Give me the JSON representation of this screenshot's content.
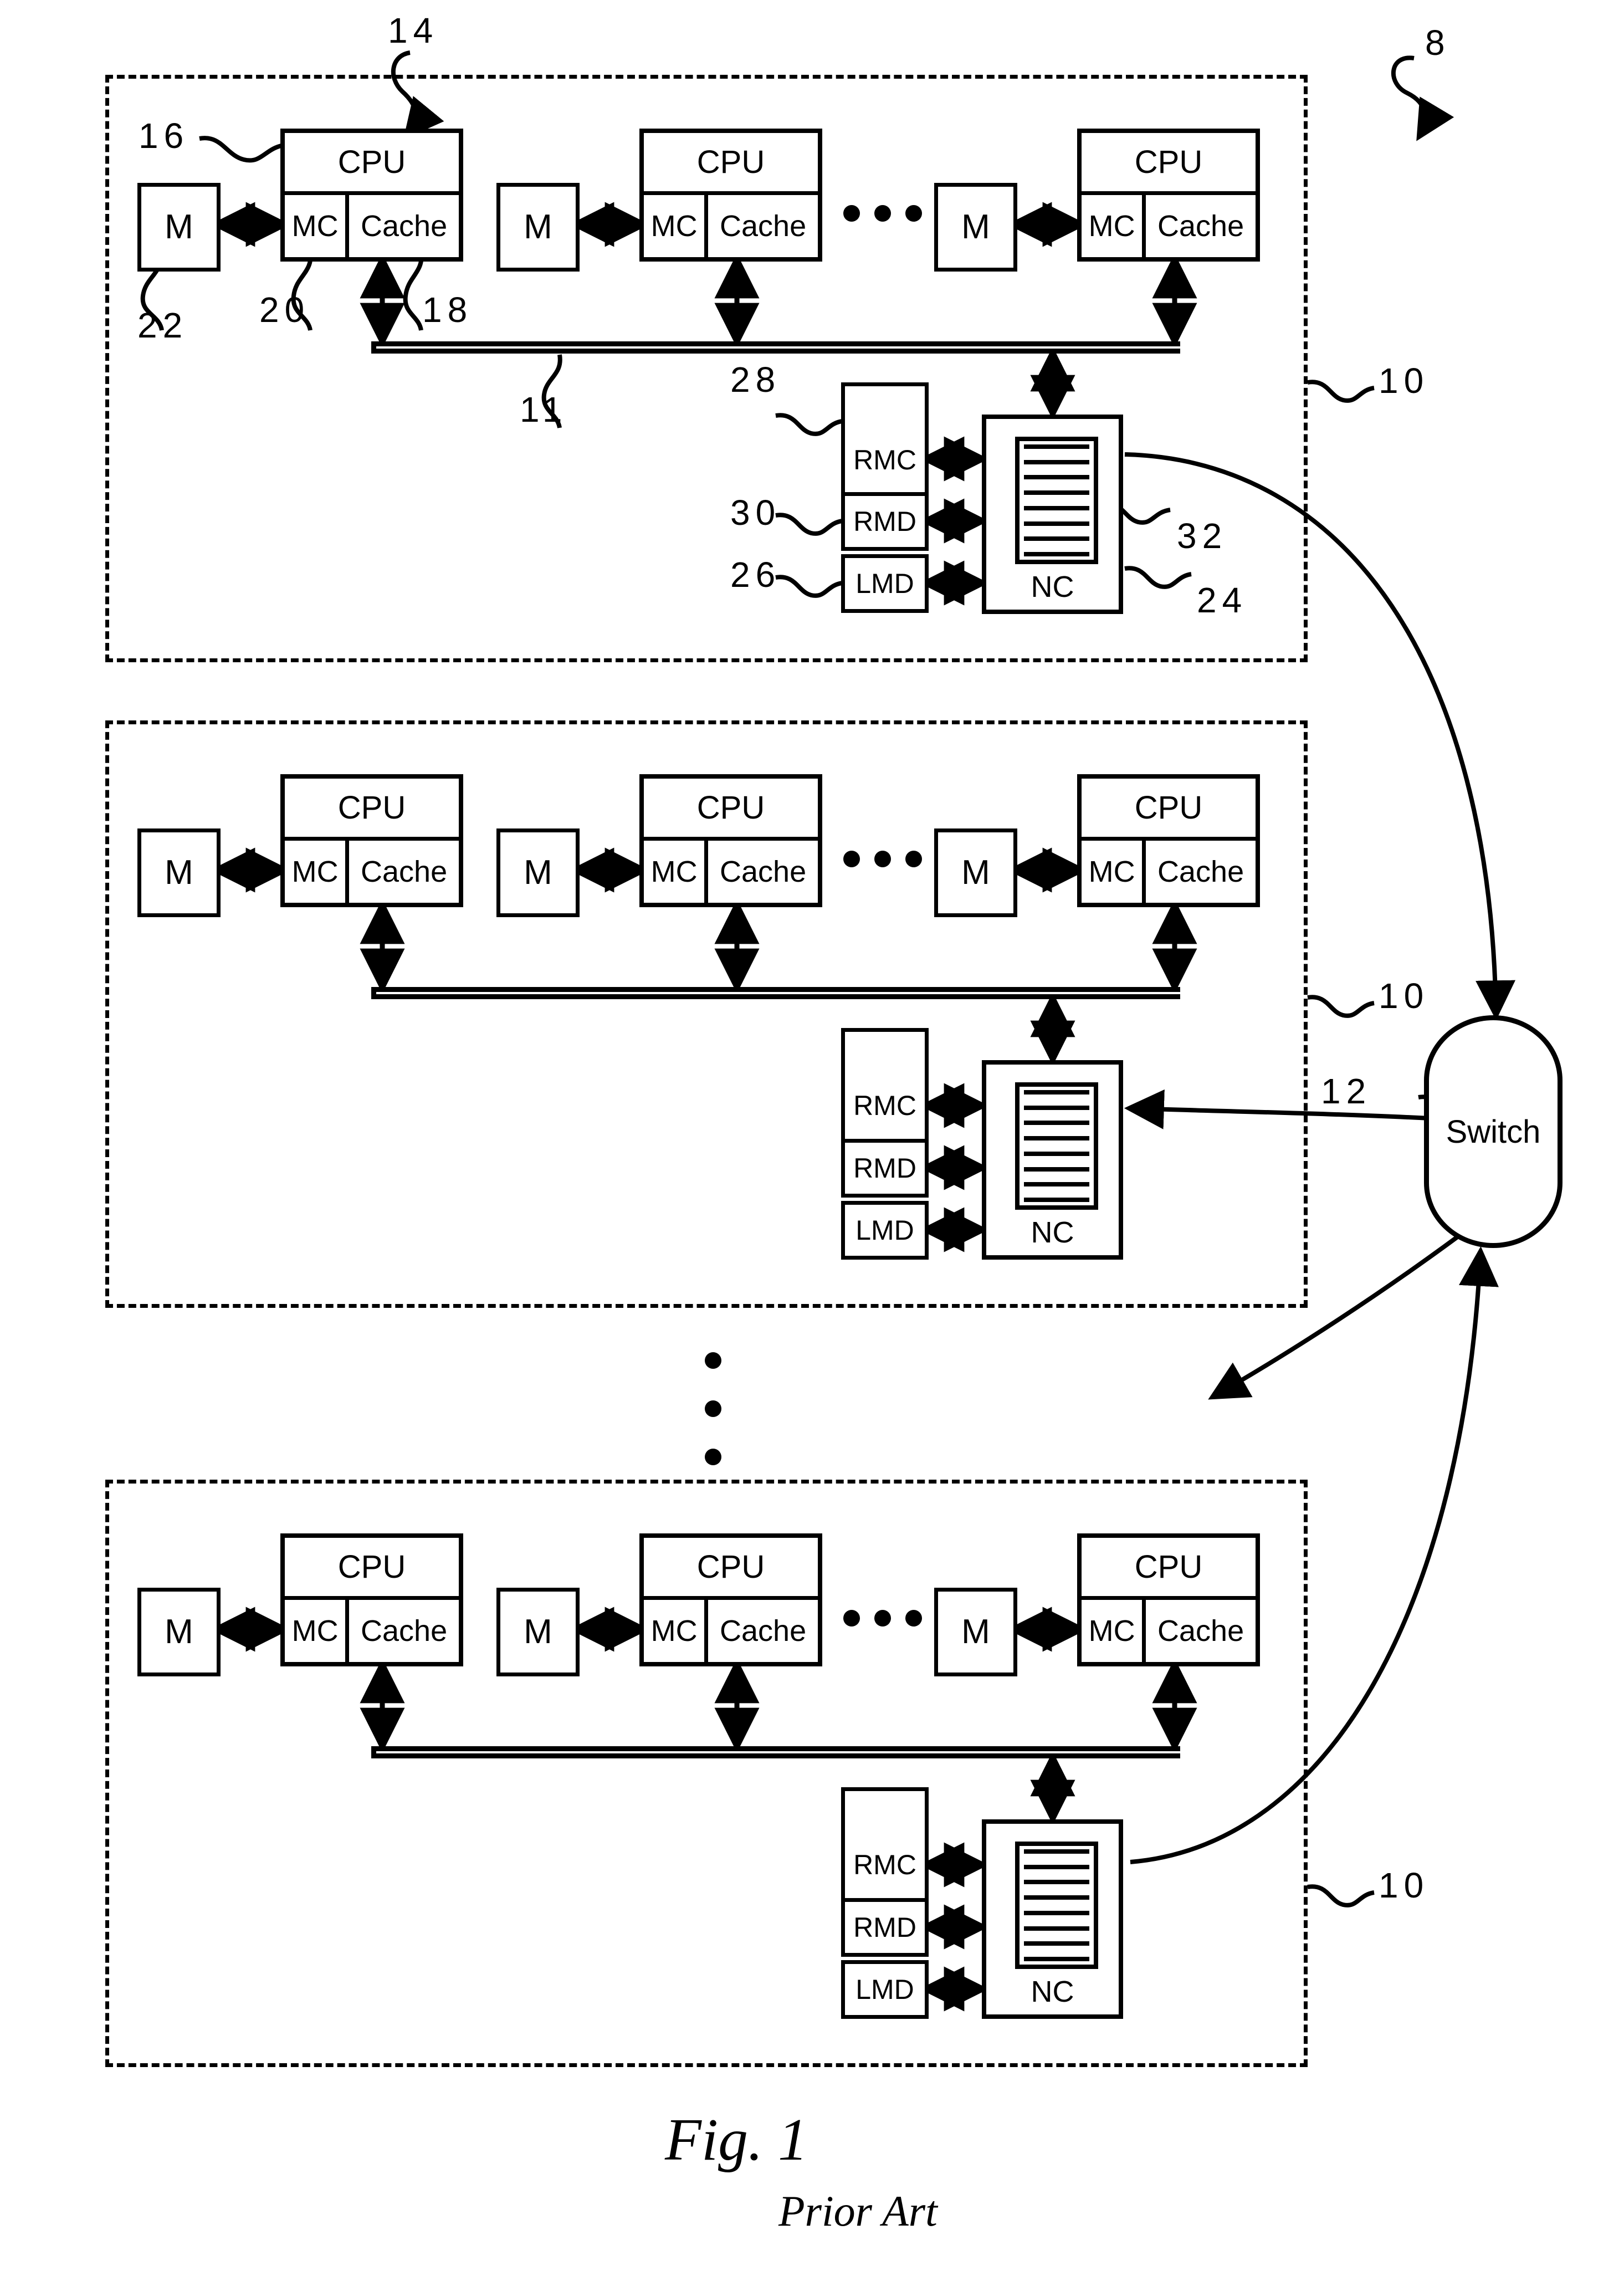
{
  "figure": {
    "caption_main": "Fig.  1",
    "caption_sub": "Prior Art",
    "system_ref": "8"
  },
  "labels": {
    "cpu": "CPU",
    "mc": "MC",
    "cache": "Cache",
    "memory": "M",
    "rmc": "RMC",
    "rmd": "RMD",
    "lmd": "LMD",
    "nc": "NC",
    "switch": "Switch",
    "ellipsis": "• • •"
  },
  "refs": {
    "system": "8",
    "node": "10",
    "bus": "11",
    "interconnect": "12",
    "cpu": "14",
    "processing_unit": "16",
    "cache_ref": "18",
    "mc_ref": "20",
    "memory_ref": "22",
    "nc_ref": "24",
    "lmd_ref": "26",
    "rmc_ref": "28",
    "rmd_ref": "30",
    "queue_ref": "32"
  },
  "nodes": [
    {
      "id": "node-1",
      "ref": "10",
      "bus_ref": "11",
      "processors": [
        {
          "memory": "M",
          "cpu": "CPU",
          "mc": "MC",
          "cache": "Cache"
        },
        {
          "memory": "M",
          "cpu": "CPU",
          "mc": "MC",
          "cache": "Cache"
        },
        {
          "memory": "M",
          "cpu": "CPU",
          "mc": "MC",
          "cache": "Cache"
        }
      ],
      "directories": [
        {
          "name": "RMC",
          "ref": "28"
        },
        {
          "name": "RMD",
          "ref": "30"
        },
        {
          "name": "LMD",
          "ref": "26"
        }
      ],
      "controller": {
        "name": "NC",
        "ref": "24",
        "queue_ref": "32",
        "queue_slots": 8
      },
      "annotated": true
    },
    {
      "id": "node-2",
      "ref": "10",
      "bus_ref": "",
      "processors": [
        {
          "memory": "M",
          "cpu": "CPU",
          "mc": "MC",
          "cache": "Cache"
        },
        {
          "memory": "M",
          "cpu": "CPU",
          "mc": "MC",
          "cache": "Cache"
        },
        {
          "memory": "M",
          "cpu": "CPU",
          "mc": "MC",
          "cache": "Cache"
        }
      ],
      "directories": [
        {
          "name": "RMC",
          "ref": ""
        },
        {
          "name": "RMD",
          "ref": ""
        },
        {
          "name": "LMD",
          "ref": ""
        }
      ],
      "controller": {
        "name": "NC",
        "ref": "",
        "queue_ref": "",
        "queue_slots": 8
      },
      "annotated": false
    },
    {
      "id": "node-n",
      "ref": "10",
      "bus_ref": "",
      "processors": [
        {
          "memory": "M",
          "cpu": "CPU",
          "mc": "MC",
          "cache": "Cache"
        },
        {
          "memory": "M",
          "cpu": "CPU",
          "mc": "MC",
          "cache": "Cache"
        },
        {
          "memory": "M",
          "cpu": "CPU",
          "mc": "MC",
          "cache": "Cache"
        }
      ],
      "directories": [
        {
          "name": "RMC",
          "ref": ""
        },
        {
          "name": "RMD",
          "ref": ""
        },
        {
          "name": "LMD",
          "ref": ""
        }
      ],
      "controller": {
        "name": "NC",
        "ref": "",
        "queue_ref": "",
        "queue_slots": 8
      },
      "annotated": false
    }
  ],
  "colors": {
    "ink": "#000000",
    "paper": "#ffffff"
  }
}
